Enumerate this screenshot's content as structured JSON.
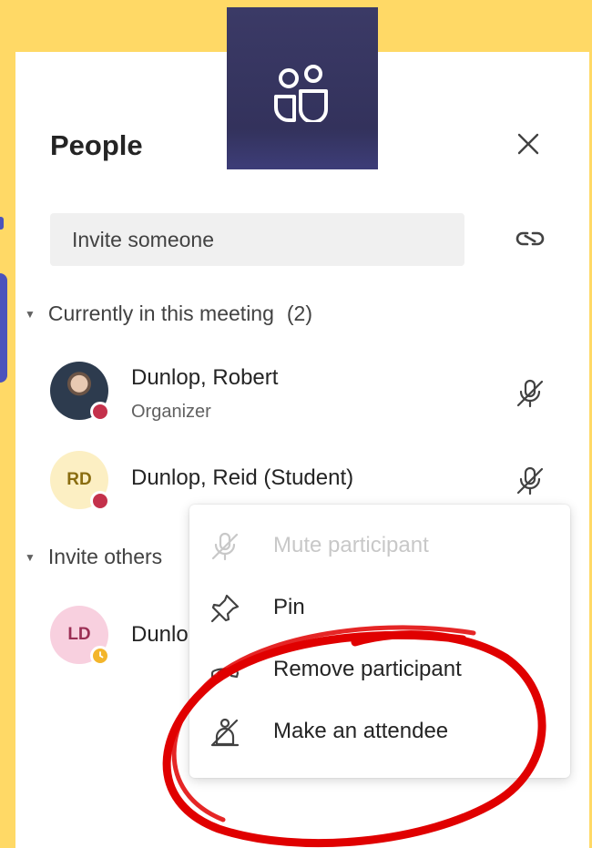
{
  "panel": {
    "title": "People"
  },
  "invite": {
    "placeholder": "Invite someone"
  },
  "sections": {
    "current": {
      "label": "Currently in this meeting",
      "count": "(2)"
    },
    "invite_others": {
      "label": "Invite others"
    }
  },
  "participants": [
    {
      "name": "Dunlop, Robert",
      "role": "Organizer",
      "status": "busy"
    },
    {
      "name": "Dunlop, Reid (Student)",
      "initials": "RD",
      "status": "busy"
    }
  ],
  "invitees": [
    {
      "name": "Dunlo",
      "initials": "LD",
      "status": "away"
    }
  ],
  "context_menu": {
    "items": [
      {
        "label": "Mute participant",
        "icon": "mic-off-icon",
        "enabled": false
      },
      {
        "label": "Pin",
        "icon": "pin-icon",
        "enabled": true
      },
      {
        "label": "Remove participant",
        "icon": "hang-up-icon",
        "enabled": true
      },
      {
        "label": "Make an attendee",
        "icon": "make-attendee-icon",
        "enabled": true
      }
    ]
  },
  "colors": {
    "background": "#FFD966",
    "accent": "#4B53BC",
    "badge": "#33325C",
    "busy": "#C4314B",
    "away": "#F3B52B",
    "annotation": "#E00000"
  }
}
